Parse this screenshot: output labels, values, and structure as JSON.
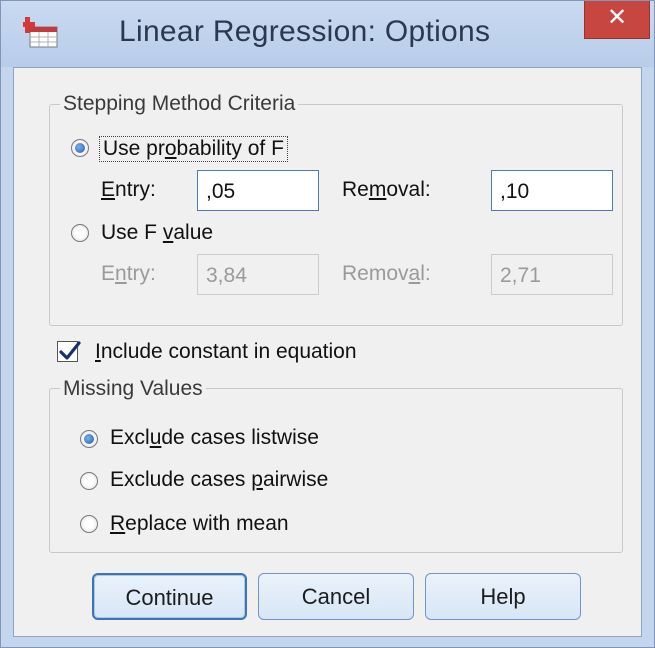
{
  "window": {
    "title": "Linear Regression: Options",
    "close_label": "✕"
  },
  "stepping": {
    "group_label": "Stepping Method Criteria",
    "prob_radio": {
      "pre": "Use pr",
      "u": "o",
      "post": "bability of F",
      "selected": true
    },
    "prob_entry": {
      "pre": "",
      "u": "E",
      "post": "ntry:",
      "value": ",05"
    },
    "prob_removal": {
      "pre": "Re",
      "u": "m",
      "post": "oval:",
      "value": ",10"
    },
    "f_radio": {
      "pre": "Use F ",
      "u": "v",
      "post": "alue",
      "selected": false
    },
    "f_entry": {
      "pre": "E",
      "u": "n",
      "post": "try:",
      "value": "3,84"
    },
    "f_removal": {
      "pre": "Remov",
      "u": "a",
      "post": "l:",
      "value": "2,71"
    }
  },
  "include_constant": {
    "pre": "",
    "u": "I",
    "post": "nclude constant in equation",
    "checked": true
  },
  "missing": {
    "group_label": "Missing Values",
    "options": [
      {
        "pre": "Excl",
        "u": "u",
        "post": "de cases listwise",
        "selected": true
      },
      {
        "pre": "Exclude cases ",
        "u": "p",
        "post": "airwise",
        "selected": false
      },
      {
        "pre": "",
        "u": "R",
        "post": "eplace with mean",
        "selected": false
      }
    ]
  },
  "buttons": {
    "continue": "Continue",
    "cancel": "Cancel",
    "help": "Help"
  }
}
